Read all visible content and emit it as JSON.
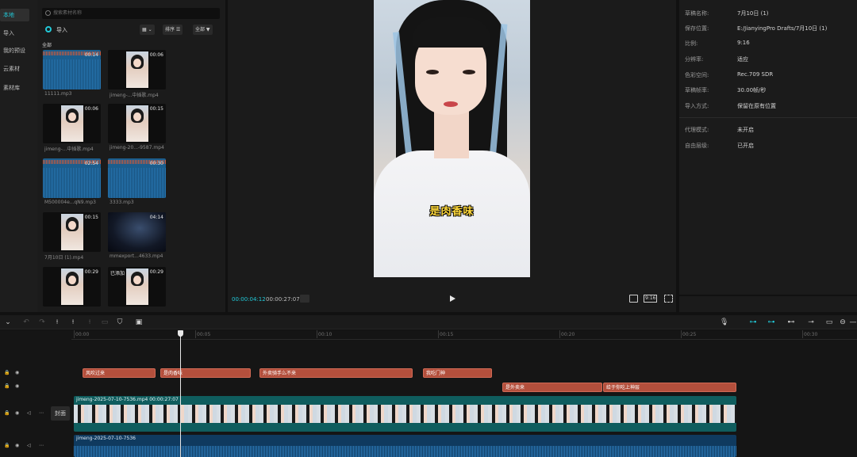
{
  "nav": {
    "items": [
      {
        "label": "本地",
        "active": true
      },
      {
        "label": "导入",
        "active": false
      },
      {
        "label": "我的预设",
        "active": false
      },
      {
        "label": "云素材",
        "active": false
      },
      {
        "label": "素材库",
        "active": false
      }
    ]
  },
  "media": {
    "search_placeholder": "搜索素材名称",
    "import_label": "导入",
    "view_label": "▦ ⌄",
    "sort_label": "排序 ☰",
    "filter_label": "全部 ▼",
    "section_label": "全部",
    "items": [
      {
        "name": "11111.mp3",
        "duration": "00:14",
        "kind": "audio"
      },
      {
        "name": "jimeng-...中插歌.mp4",
        "duration": "00:06",
        "kind": "portrait"
      },
      {
        "name": "jimeng-...中插歌.mp4",
        "duration": "00:06",
        "kind": "portrait"
      },
      {
        "name": "jimeng-20...-9587.mp4",
        "duration": "00:15",
        "kind": "portrait"
      },
      {
        "name": "M500004e...qN9.mp3",
        "duration": "02:54",
        "kind": "audio"
      },
      {
        "name": "3333.mp3",
        "duration": "00:30",
        "kind": "audio"
      },
      {
        "name": "7月10日 (1).mp4",
        "duration": "00:15",
        "kind": "portrait"
      },
      {
        "name": "mmexport...4633.mp4",
        "duration": "04:14",
        "kind": "night"
      },
      {
        "name": "",
        "duration": "00:29",
        "kind": "portrait",
        "badge": ""
      },
      {
        "name": "",
        "duration": "00:29",
        "kind": "portrait",
        "badge": "已添加"
      }
    ]
  },
  "player": {
    "subtitle": "是肉香味",
    "current_time": "00:00:04:12",
    "total_time": "00:00:27:07",
    "ratio_label": "9:16"
  },
  "info": {
    "rows": [
      {
        "key": "草稿名称:",
        "value": "7月10日 (1)"
      },
      {
        "key": "保存位置:",
        "value": "E:/JianyingPro Drafts/7月10日 (1)"
      },
      {
        "key": "比例:",
        "value": "9:16"
      },
      {
        "key": "分辨率:",
        "value": "适应"
      },
      {
        "key": "色彩空间:",
        "value": "Rec.709 SDR"
      },
      {
        "key": "草稿帧率:",
        "value": "30.00帧/秒"
      },
      {
        "key": "导入方式:",
        "value": "保留在原有位置"
      },
      {
        "key": "代理模式:",
        "value": "未开启"
      },
      {
        "key": "自由层级:",
        "value": "已开启"
      }
    ]
  },
  "timeline": {
    "ruler": [
      "00:00",
      "00:05",
      "00:10",
      "00:15",
      "00:20",
      "00:25",
      "00:30"
    ],
    "text_track_1": [
      "风吹过来",
      "是肉香味",
      "外卖骑手么不来",
      "我吃门神"
    ],
    "text_track_2": [
      "是外卖来",
      "给于你吃上神层"
    ],
    "video_clip": "jimeng-2025-07-10-7536.mp4   00:00:27:07",
    "audio_clip": "jimeng-2025-07-10-7536",
    "cover_label": "封面"
  }
}
